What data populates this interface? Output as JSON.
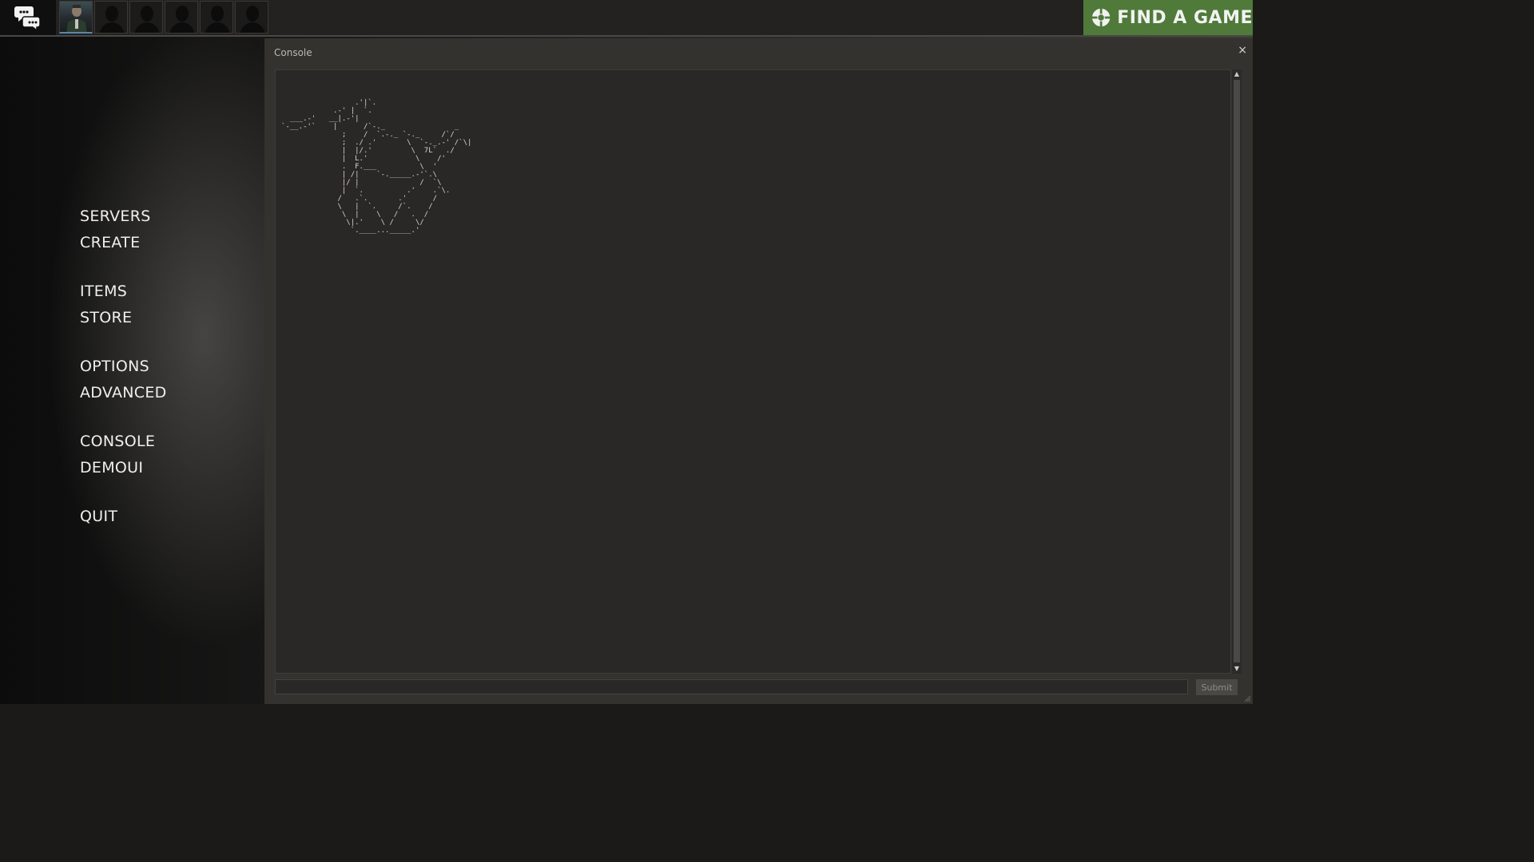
{
  "topbar": {
    "chat_icon": "chat-bubbles-icon",
    "avatars": [
      {
        "icon": "player-portrait-icon",
        "filled": true
      },
      {
        "icon": "empty-slot-silhouette-icon",
        "filled": false
      },
      {
        "icon": "empty-slot-silhouette-icon",
        "filled": false
      },
      {
        "icon": "empty-slot-silhouette-icon",
        "filled": false
      },
      {
        "icon": "empty-slot-silhouette-icon",
        "filled": false
      },
      {
        "icon": "empty-slot-silhouette-icon",
        "filled": false
      }
    ],
    "find_game": {
      "label": "FIND A GAME",
      "icon": "tf2-logo-icon",
      "color": "#4f7a3a"
    }
  },
  "menu": {
    "servers": "SERVERS",
    "create": "CREATE",
    "items": "ITEMS",
    "store": "STORE",
    "options": "OPTIONS",
    "advanced": "ADVANCED",
    "console": "CONSOLE",
    "demoui": "DEMOUI",
    "quit": "QUIT"
  },
  "console": {
    "title": "Console",
    "close_glyph": "×",
    "output": "                 .'|`.\n            .-' |  `.\n  ___.-'   __|.-'|\n`-__.-'`    |      /`-._                _\n              ;    /  `.-._ `-._     /`/\n              ;  ./ .'       \\  `-._.-' /`\\|\n              |  |/.'         \\  7L`  ./\n              |  L.'           \\    /'\n              .  F.___          \\  '\n              | /|    `-._____.-'`.\\\n              |/ |              /  `\\\n              |  `.          .'    .`\\.\n             /   .`.       .'      / \n             \\   |  `.     /`.    /\n              \\  |    \\   /   .  /\n               \\|.'    \\ /     \\/\n                `.____..._____.'",
    "input_value": "",
    "submit_label": "Submit",
    "scroll_up_glyph": "▲",
    "scroll_down_glyph": "▼"
  }
}
